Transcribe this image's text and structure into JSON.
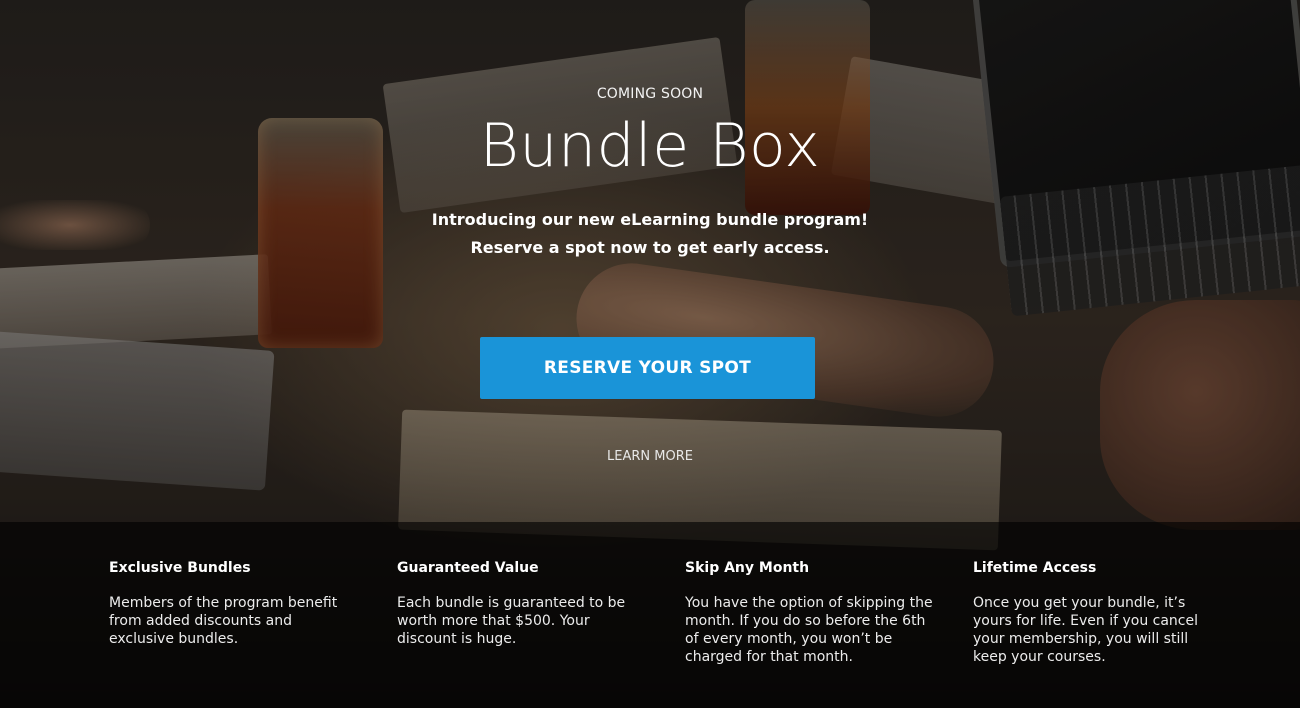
{
  "hero": {
    "eyebrow": "COMING SOON",
    "title": "Bundle Box",
    "intro_line1": "Introducing our new eLearning bundle program!",
    "intro_line2": "Reserve a spot now to get early access.",
    "cta_label": "RESERVE YOUR SPOT",
    "learn_more_label": "LEARN MORE"
  },
  "features": [
    {
      "title": "Exclusive Bundles",
      "text": "Members of the program benefit from added discounts and exclusive bundles."
    },
    {
      "title": "Guaranteed Value",
      "text": "Each bundle is guaranteed to be worth more that $500.  Your discount is huge."
    },
    {
      "title": "Skip Any Month",
      "text": "You have the option of skipping the month. If you do so before the 6th of every month, you won’t be charged for that month."
    },
    {
      "title": "Lifetime Access",
      "text": "Once you get your bundle, it’s yours for life. Even if you cancel your membership, you will still keep your courses."
    }
  ],
  "colors": {
    "accent": "#1a94d8",
    "text": "#ffffff",
    "feature_bar": "#000000"
  }
}
